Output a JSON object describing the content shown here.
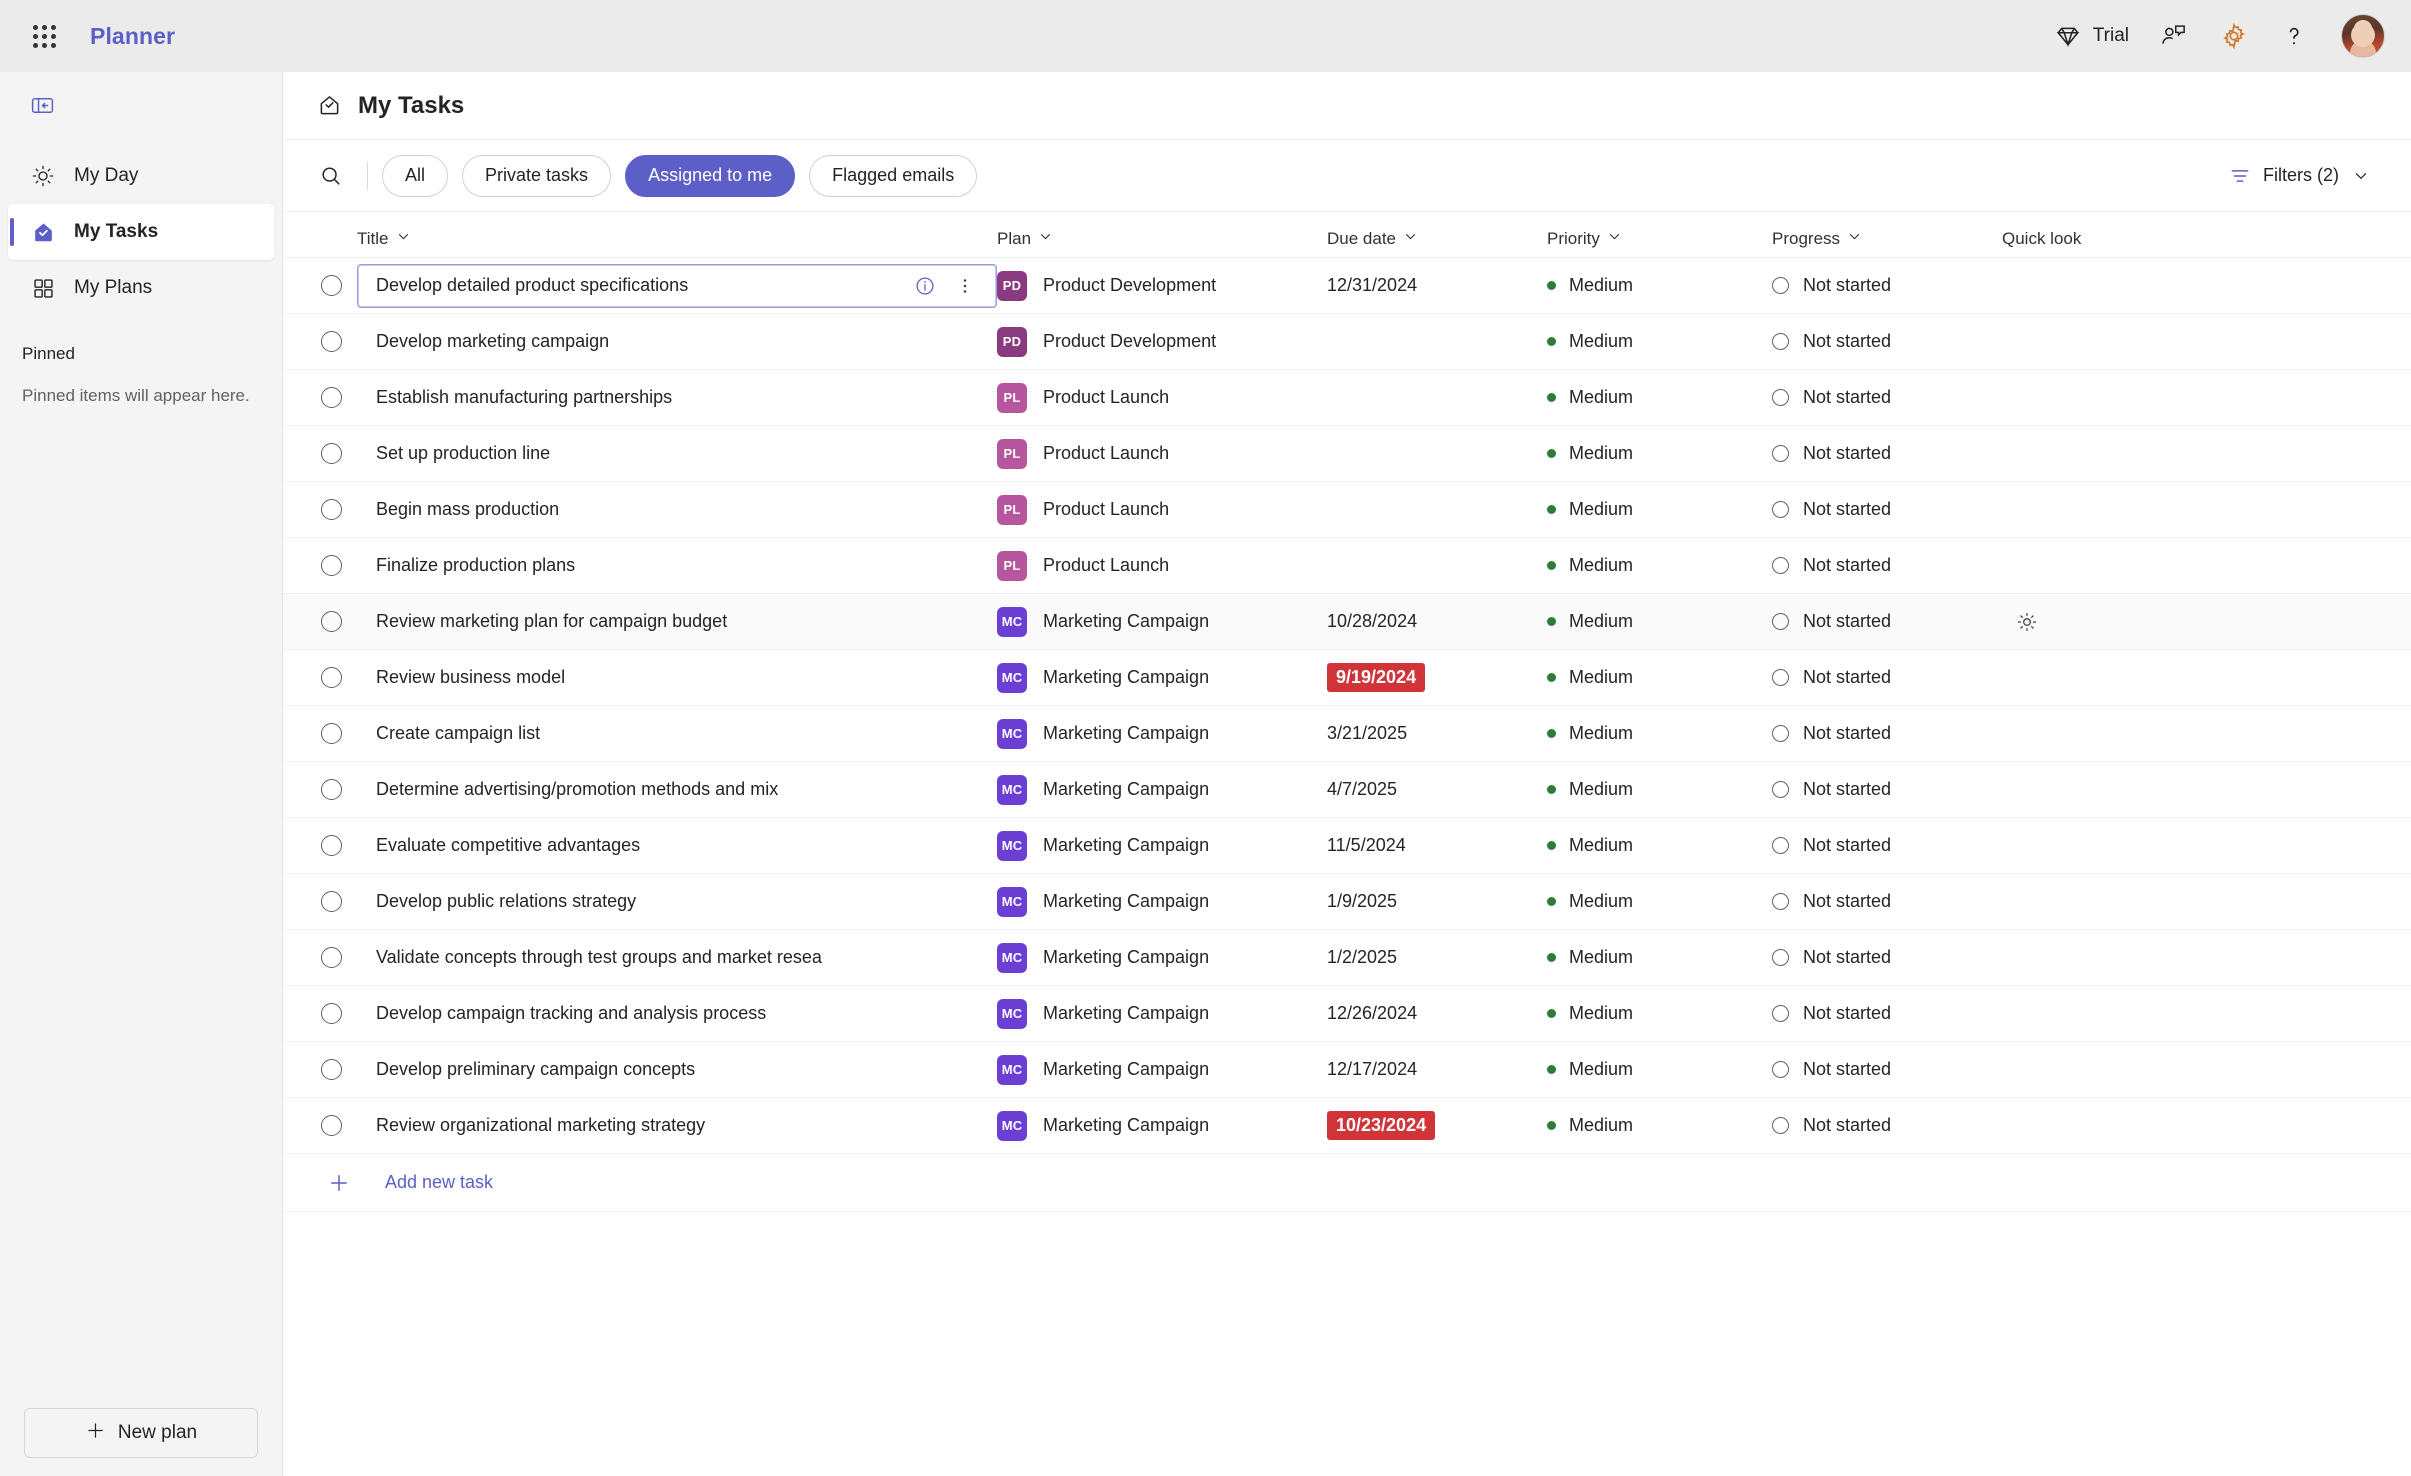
{
  "topbar": {
    "waffle_icon": "app-launcher-icon",
    "brand": "Planner",
    "trial_label": "Trial",
    "trial_icon": "diamond-icon",
    "feedback_icon": "feedback-person-icon",
    "settings_icon": "gear-icon",
    "help_icon": "help-question-icon",
    "avatar_icon": "user-avatar"
  },
  "sidebar": {
    "collapse_icon": "collapse-panel-icon",
    "items": [
      {
        "label": "My Day",
        "icon": "sun-icon",
        "active": false
      },
      {
        "label": "My Tasks",
        "icon": "tasks-envelope-check-icon",
        "active": true
      },
      {
        "label": "My Plans",
        "icon": "grid-four-squares-icon",
        "active": false
      }
    ],
    "pinned_heading": "Pinned",
    "pinned_empty": "Pinned items will appear here.",
    "new_plan_label": "New plan",
    "new_plan_icon": "plus-icon"
  },
  "page": {
    "title": "My Tasks",
    "title_icon": "tasks-envelope-check-icon"
  },
  "toolbar": {
    "search_icon": "search-icon",
    "pills": [
      {
        "label": "All",
        "active": false
      },
      {
        "label": "Private tasks",
        "active": false
      },
      {
        "label": "Assigned to me",
        "active": true
      },
      {
        "label": "Flagged emails",
        "active": false
      }
    ],
    "filters_label": "Filters (2)",
    "filters_icon": "filter-icon",
    "filters_chevron": "chevron-down-icon"
  },
  "colors": {
    "brand_purple": "#5b5fc7",
    "overdue_red": "#d13438",
    "priority_medium_green": "#2d7d3a",
    "plan_pd": "#8a3a7e",
    "plan_pl": "#b5569e",
    "plan_mc": "#6b3fd4"
  },
  "table": {
    "columns": [
      {
        "label": "Title",
        "chevron": true
      },
      {
        "label": "Plan",
        "chevron": true
      },
      {
        "label": "Due date",
        "chevron": true
      },
      {
        "label": "Priority",
        "chevron": true
      },
      {
        "label": "Progress",
        "chevron": true
      },
      {
        "label": "Quick look",
        "chevron": false
      }
    ],
    "rows": [
      {
        "title": "Develop detailed product specifications",
        "plan_initials": "PD",
        "plan_color": "#8a3a7e",
        "plan": "Product Development",
        "due": "12/31/2024",
        "overdue": false,
        "priority": "Medium",
        "progress": "Not started",
        "focused": true,
        "hovered": false,
        "quick_look": ""
      },
      {
        "title": "Develop marketing campaign",
        "plan_initials": "PD",
        "plan_color": "#8a3a7e",
        "plan": "Product Development",
        "due": "",
        "overdue": false,
        "priority": "Medium",
        "progress": "Not started",
        "focused": false,
        "hovered": false,
        "quick_look": ""
      },
      {
        "title": "Establish manufacturing partnerships",
        "plan_initials": "PL",
        "plan_color": "#b5569e",
        "plan": "Product Launch",
        "due": "",
        "overdue": false,
        "priority": "Medium",
        "progress": "Not started",
        "focused": false,
        "hovered": false,
        "quick_look": ""
      },
      {
        "title": "Set up production line",
        "plan_initials": "PL",
        "plan_color": "#b5569e",
        "plan": "Product Launch",
        "due": "",
        "overdue": false,
        "priority": "Medium",
        "progress": "Not started",
        "focused": false,
        "hovered": false,
        "quick_look": ""
      },
      {
        "title": "Begin mass production",
        "plan_initials": "PL",
        "plan_color": "#b5569e",
        "plan": "Product Launch",
        "due": "",
        "overdue": false,
        "priority": "Medium",
        "progress": "Not started",
        "focused": false,
        "hovered": false,
        "quick_look": ""
      },
      {
        "title": "Finalize production plans",
        "plan_initials": "PL",
        "plan_color": "#b5569e",
        "plan": "Product Launch",
        "due": "",
        "overdue": false,
        "priority": "Medium",
        "progress": "Not started",
        "focused": false,
        "hovered": false,
        "quick_look": ""
      },
      {
        "title": "Review marketing plan for campaign budget",
        "plan_initials": "MC",
        "plan_color": "#6b3fd4",
        "plan": "Marketing Campaign",
        "due": "10/28/2024",
        "overdue": false,
        "priority": "Medium",
        "progress": "Not started",
        "focused": false,
        "hovered": true,
        "quick_look": "sun-icon"
      },
      {
        "title": "Review business model",
        "plan_initials": "MC",
        "plan_color": "#6b3fd4",
        "plan": "Marketing Campaign",
        "due": "9/19/2024",
        "overdue": true,
        "priority": "Medium",
        "progress": "Not started",
        "focused": false,
        "hovered": false,
        "quick_look": ""
      },
      {
        "title": "Create campaign list",
        "plan_initials": "MC",
        "plan_color": "#6b3fd4",
        "plan": "Marketing Campaign",
        "due": "3/21/2025",
        "overdue": false,
        "priority": "Medium",
        "progress": "Not started",
        "focused": false,
        "hovered": false,
        "quick_look": ""
      },
      {
        "title": "Determine advertising/promotion methods and mix",
        "plan_initials": "MC",
        "plan_color": "#6b3fd4",
        "plan": "Marketing Campaign",
        "due": "4/7/2025",
        "overdue": false,
        "priority": "Medium",
        "progress": "Not started",
        "focused": false,
        "hovered": false,
        "quick_look": ""
      },
      {
        "title": "Evaluate competitive advantages",
        "plan_initials": "MC",
        "plan_color": "#6b3fd4",
        "plan": "Marketing Campaign",
        "due": "11/5/2024",
        "overdue": false,
        "priority": "Medium",
        "progress": "Not started",
        "focused": false,
        "hovered": false,
        "quick_look": ""
      },
      {
        "title": "Develop public relations strategy",
        "plan_initials": "MC",
        "plan_color": "#6b3fd4",
        "plan": "Marketing Campaign",
        "due": "1/9/2025",
        "overdue": false,
        "priority": "Medium",
        "progress": "Not started",
        "focused": false,
        "hovered": false,
        "quick_look": ""
      },
      {
        "title": "Validate concepts through test groups and market resea",
        "plan_initials": "MC",
        "plan_color": "#6b3fd4",
        "plan": "Marketing Campaign",
        "due": "1/2/2025",
        "overdue": false,
        "priority": "Medium",
        "progress": "Not started",
        "focused": false,
        "hovered": false,
        "quick_look": ""
      },
      {
        "title": "Develop campaign tracking and analysis process",
        "plan_initials": "MC",
        "plan_color": "#6b3fd4",
        "plan": "Marketing Campaign",
        "due": "12/26/2024",
        "overdue": false,
        "priority": "Medium",
        "progress": "Not started",
        "focused": false,
        "hovered": false,
        "quick_look": ""
      },
      {
        "title": "Develop preliminary campaign concepts",
        "plan_initials": "MC",
        "plan_color": "#6b3fd4",
        "plan": "Marketing Campaign",
        "due": "12/17/2024",
        "overdue": false,
        "priority": "Medium",
        "progress": "Not started",
        "focused": false,
        "hovered": false,
        "quick_look": ""
      },
      {
        "title": "Review organizational marketing strategy",
        "plan_initials": "MC",
        "plan_color": "#6b3fd4",
        "plan": "Marketing Campaign",
        "due": "10/23/2024",
        "overdue": true,
        "priority": "Medium",
        "progress": "Not started",
        "focused": false,
        "hovered": false,
        "quick_look": ""
      }
    ],
    "add_task_label": "Add new task",
    "add_task_icon": "plus-icon",
    "row_info_icon": "info-circle-icon",
    "row_more_icon": "more-vertical-icon",
    "checkbox_icon": "task-complete-circle-icon"
  }
}
